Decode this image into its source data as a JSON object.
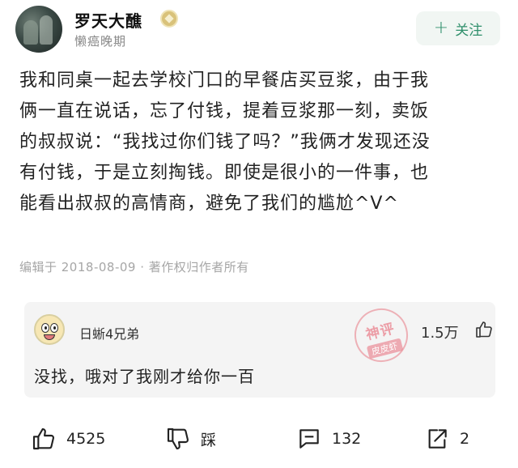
{
  "post": {
    "author_name": "罗天大醮",
    "author_subtitle": "懒癌晚期",
    "follow_label": "关注",
    "body_lines": [
      "我和同桌一起去学校门口的早餐店买豆浆，由于我",
      "俩一直在说话，忘了付钱，提着豆浆那一刻，卖饭",
      "的叔叔说：“我找过你们钱了吗？”我俩才发现还没",
      "有付钱，于是立刻掏钱。即使是很小的一件事，也",
      "能看出叔叔的高情商，避免了我们的尴尬^V^"
    ],
    "meta": "编辑于 2018-08-09 · 著作权归作者所有"
  },
  "comment": {
    "username": "日蜥4兄弟",
    "likes": "1.5万",
    "text": "没找，哦对了我刚才给你一百",
    "stamp_top": "神评",
    "stamp_bottom": "皮皮虾"
  },
  "actions": {
    "like_count": "4525",
    "dislike_label": "踩",
    "comment_count": "132",
    "share_count": "2"
  },
  "colors": {
    "accent_green": "#2f8f6b",
    "stamp_pink": "#e86e7c"
  },
  "icons": [
    "plus-icon",
    "verified-badge-icon",
    "thumb-up-icon",
    "thumb-down-icon",
    "comment-icon",
    "share-icon"
  ]
}
